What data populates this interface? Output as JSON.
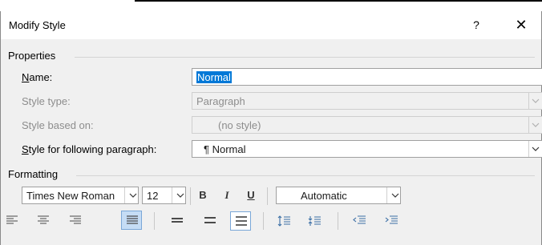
{
  "dialog": {
    "title": "Modify Style",
    "help_label": "?",
    "close_label": "✕"
  },
  "properties": {
    "heading": "Properties",
    "name": {
      "label_key": "N",
      "label_rest": "ame:",
      "value": "Normal"
    },
    "style_type": {
      "label": "Style type:",
      "value": "Paragraph"
    },
    "style_based_on": {
      "label": "Style based on:",
      "value": "(no style)"
    },
    "following": {
      "label_key": "S",
      "label_rest": "tyle for following paragraph:",
      "value": "¶  Normal"
    }
  },
  "formatting": {
    "heading": "Formatting",
    "font_name": "Times New Roman",
    "font_size": "12",
    "bold_label": "B",
    "italic_label": "I",
    "underline_label": "U",
    "color_value": "Automatic",
    "active_alignment": "justify"
  },
  "colors": {
    "selection": "#0078d7",
    "active_button": "#c5dcf5"
  }
}
